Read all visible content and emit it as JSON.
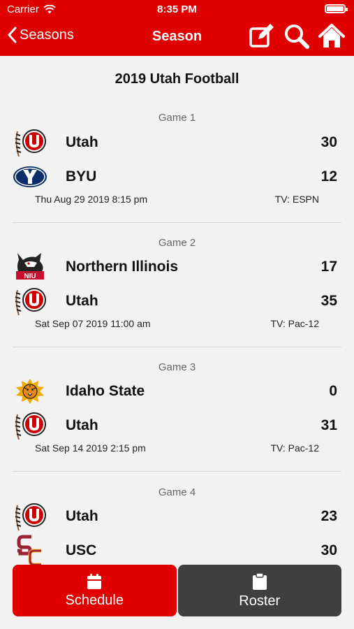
{
  "status": {
    "carrier": "Carrier",
    "time": "8:35 PM"
  },
  "nav": {
    "back_label": "Seasons",
    "title": "Season"
  },
  "season_title": "2019 Utah Football",
  "games": [
    {
      "label": "Game 1",
      "teams": [
        {
          "name": "Utah",
          "score": "30",
          "logo": "utah-logo-icon"
        },
        {
          "name": "BYU",
          "score": "12",
          "logo": "byu-logo-icon"
        }
      ],
      "date": "Thu Aug 29 2019 8:15 pm",
      "tv": "TV: ESPN"
    },
    {
      "label": "Game 2",
      "teams": [
        {
          "name": "Northern Illinois",
          "score": "17",
          "logo": "niu-logo-icon"
        },
        {
          "name": "Utah",
          "score": "35",
          "logo": "utah-logo-icon"
        }
      ],
      "date": "Sat Sep 07 2019 11:00 am",
      "tv": "TV: Pac-12"
    },
    {
      "label": "Game 3",
      "teams": [
        {
          "name": "Idaho State",
          "score": "0",
          "logo": "idaho-state-logo-icon"
        },
        {
          "name": "Utah",
          "score": "31",
          "logo": "utah-logo-icon"
        }
      ],
      "date": "Sat Sep 14 2019 2:15 pm",
      "tv": "TV: Pac-12"
    },
    {
      "label": "Game 4",
      "teams": [
        {
          "name": "Utah",
          "score": "23",
          "logo": "utah-logo-icon"
        },
        {
          "name": "USC",
          "score": "30",
          "logo": "usc-logo-icon"
        }
      ],
      "date": "",
      "tv": ""
    }
  ],
  "tabs": {
    "schedule": "Schedule",
    "roster": "Roster"
  },
  "colors": {
    "brand_red": "#e00000",
    "tab_dark": "#3f3f3f"
  }
}
